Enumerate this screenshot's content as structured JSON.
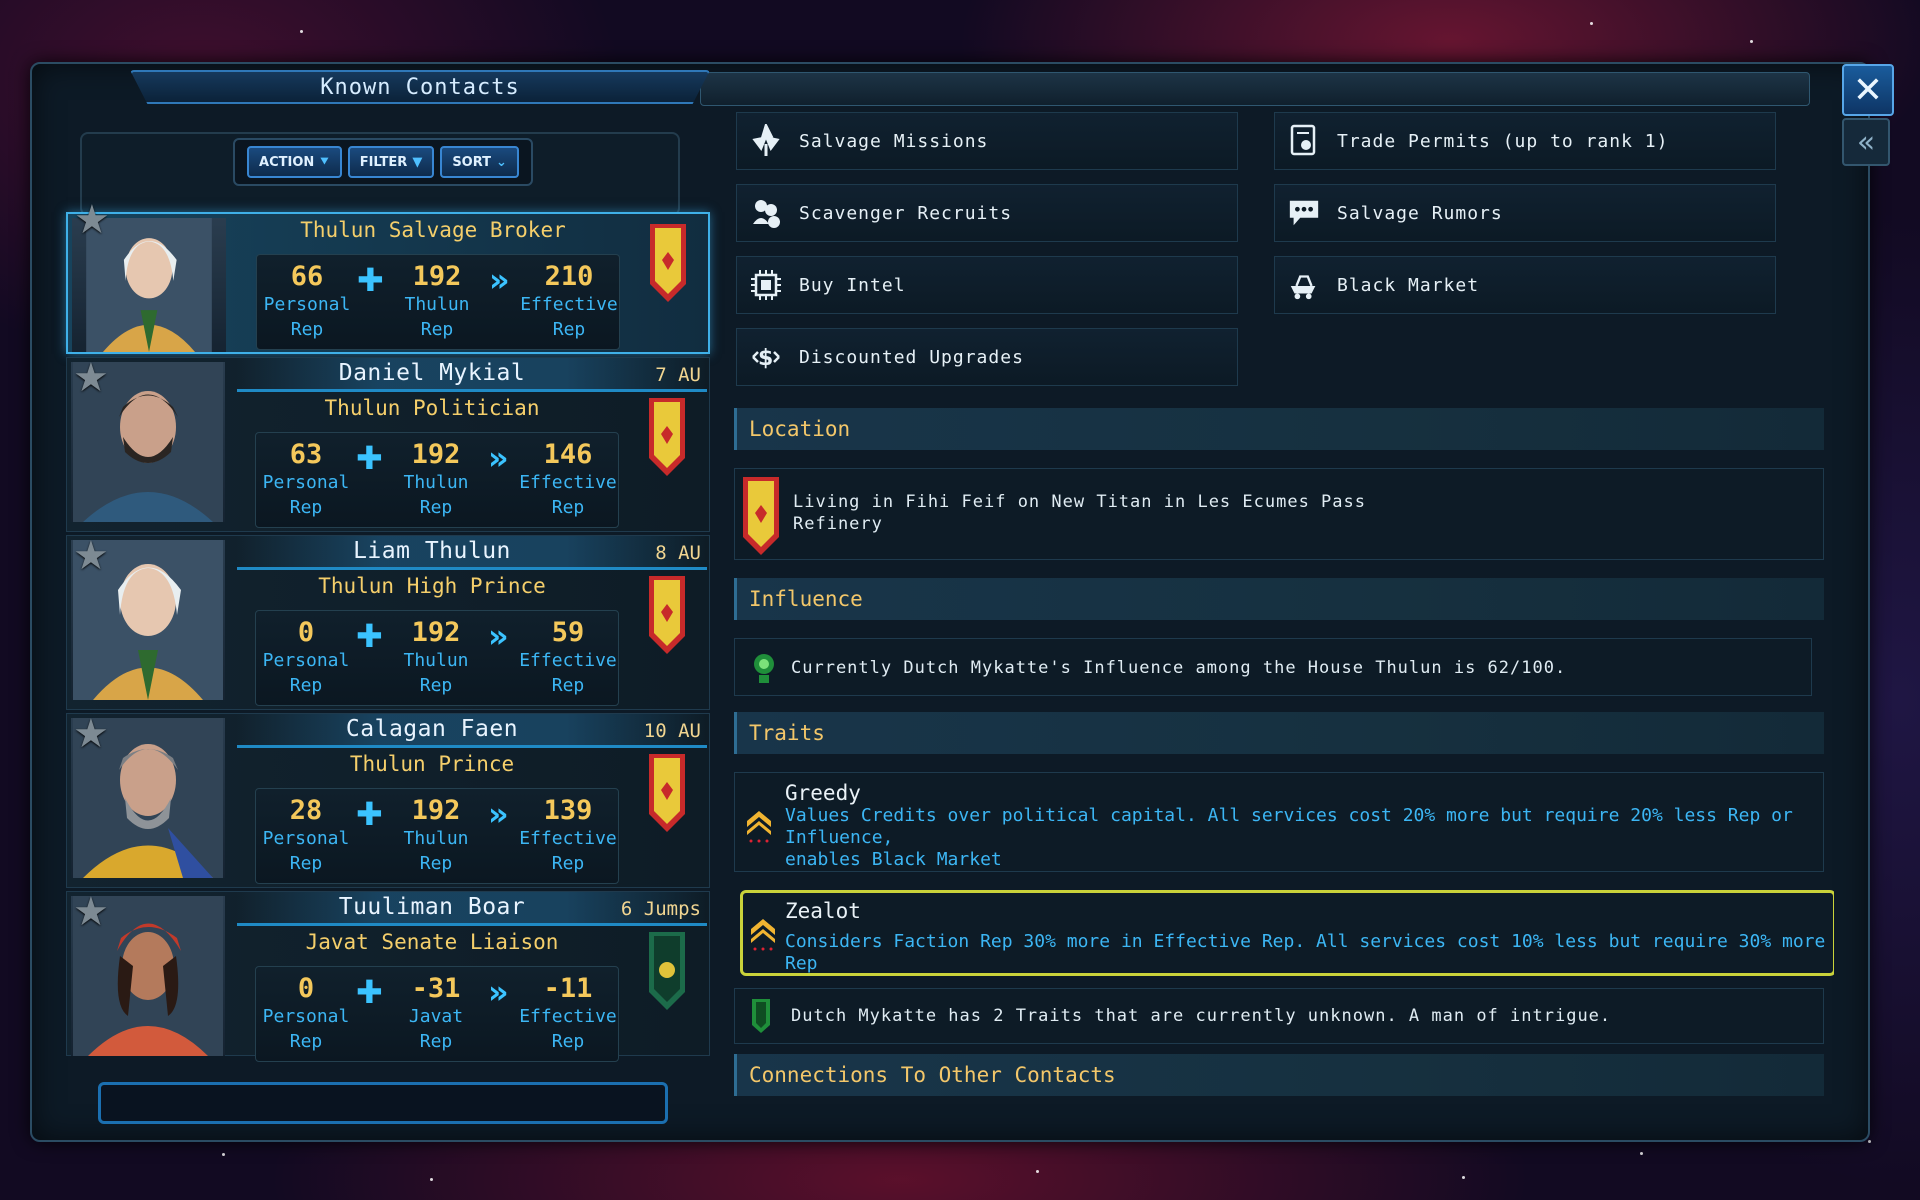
{
  "window": {
    "title": "Known Contacts",
    "close_label": "✕",
    "back_label": "«"
  },
  "toolbar": {
    "action_label": "ACTION",
    "filter_label": "FILTER",
    "sort_label": "SORT"
  },
  "contacts": [
    {
      "name": "",
      "distance": "",
      "role": "Thulun Salvage Broker",
      "personal": "66",
      "faction_rep": "192",
      "effective": "210",
      "faction_label": "Thulun",
      "banner": "red",
      "selected": true
    },
    {
      "name": "Daniel Mykial",
      "distance": "7 AU",
      "role": "Thulun Politician",
      "personal": "63",
      "faction_rep": "192",
      "effective": "146",
      "faction_label": "Thulun",
      "banner": "red"
    },
    {
      "name": "Liam Thulun",
      "distance": "8 AU",
      "role": "Thulun High Prince",
      "personal": "0",
      "faction_rep": "192",
      "effective": "59",
      "faction_label": "Thulun",
      "banner": "red"
    },
    {
      "name": "Calagan Faen",
      "distance": "10 AU",
      "role": "Thulun Prince",
      "personal": "28",
      "faction_rep": "192",
      "effective": "139",
      "faction_label": "Thulun",
      "banner": "red"
    },
    {
      "name": "Tuuliman Boar",
      "distance": "6 Jumps",
      "role": "Javat Senate Liaison",
      "personal": "0",
      "faction_rep": "-31",
      "effective": "-11",
      "faction_label": "Javat",
      "banner": "green"
    }
  ],
  "rep_labels": {
    "personal_1": "Personal",
    "rep": "Rep",
    "effective_1": "Effective"
  },
  "services": {
    "salvage_missions": "Salvage Missions",
    "trade_permits": "Trade Permits (up to rank 1)",
    "scavenger_recruits": "Scavenger Recruits",
    "salvage_rumors": "Salvage Rumors",
    "buy_intel": "Buy Intel",
    "black_market": "Black Market",
    "discounted_upgrades": "Discounted Upgrades"
  },
  "location": {
    "heading": "Location",
    "line1": "Living in Fihi Feif on New Titan in Les Ecumes Pass",
    "line2": "Refinery"
  },
  "influence": {
    "heading": "Influence",
    "text": "Currently Dutch Mykatte's Influence among the House Thulun is 62/100."
  },
  "traits": {
    "heading": "Traits",
    "greedy_title": "Greedy",
    "greedy_desc1": "Values Credits over political capital. All services cost 20% more but require 20% less Rep or Influence,",
    "greedy_desc2": "enables Black Market",
    "zealot_title": "Zealot",
    "zealot_desc": "Considers Faction Rep 30% more in Effective Rep. All services cost 10% less but require 30% more Rep",
    "unknown_text": "Dutch Mykatte has 2 Traits that are currently unknown. A man of intrigue."
  },
  "connections": {
    "heading": "Connections To Other Contacts"
  },
  "colors": {
    "accent_blue": "#3cb6f4",
    "gold": "#f4c85b",
    "highlight": "#c9d23a"
  }
}
